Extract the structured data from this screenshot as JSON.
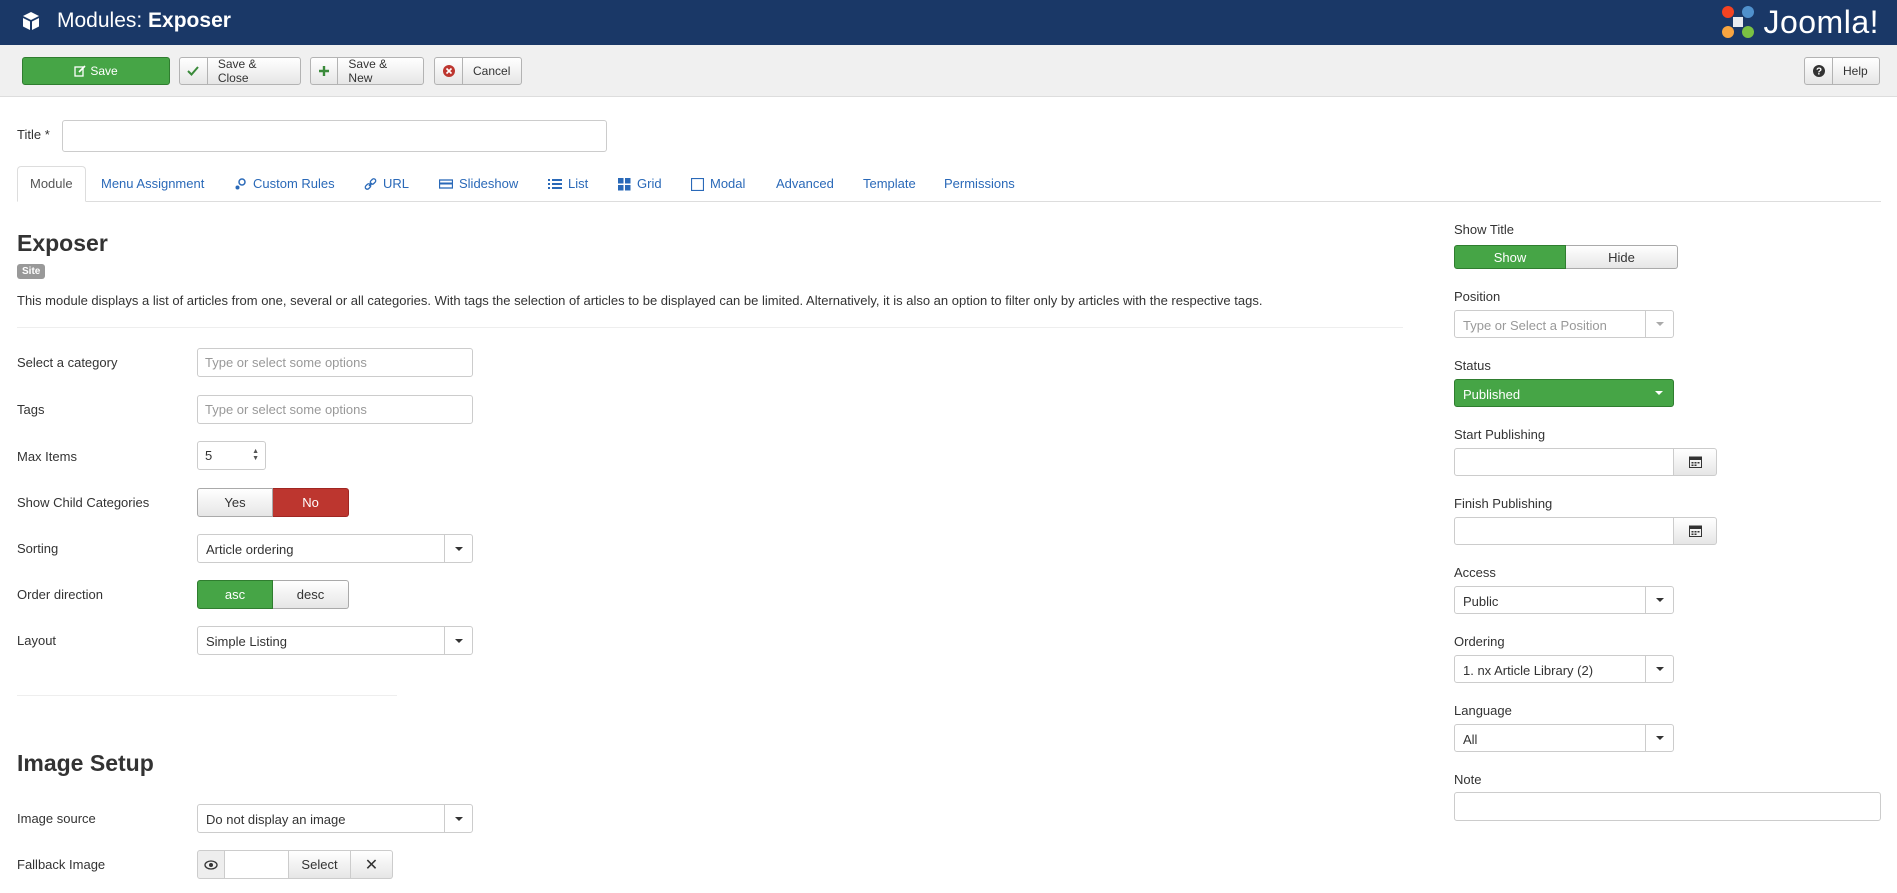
{
  "header": {
    "title_prefix": "Modules: ",
    "title_name": "Exposer",
    "brand": "Joomla!",
    "colors": {
      "bar": "#1a3867",
      "success": "#46a546",
      "danger": "#bd362f",
      "link": "#2a69b8"
    }
  },
  "toolbar": {
    "save": "Save",
    "save_close": "Save & Close",
    "save_new": "Save & New",
    "cancel": "Cancel",
    "help": "Help"
  },
  "title_field": {
    "label": "Title *",
    "value": ""
  },
  "tabs": [
    {
      "label": "Module",
      "icon": ""
    },
    {
      "label": "Menu Assignment",
      "icon": ""
    },
    {
      "label": "Custom Rules",
      "icon": "rules-icon"
    },
    {
      "label": "URL",
      "icon": "link-icon"
    },
    {
      "label": "Slideshow",
      "icon": "slideshow-icon"
    },
    {
      "label": "List",
      "icon": "list-icon"
    },
    {
      "label": "Grid",
      "icon": "grid-icon"
    },
    {
      "label": "Modal",
      "icon": "modal-icon"
    },
    {
      "label": "Advanced",
      "icon": ""
    },
    {
      "label": "Template",
      "icon": ""
    },
    {
      "label": "Permissions",
      "icon": ""
    }
  ],
  "module": {
    "name": "Exposer",
    "badge": "Site",
    "description": "This module displays a list of articles from one, several or all categories. With tags the selection of articles to be displayed can be limited. Alternatively, it is also an option to filter only by articles with the respective tags."
  },
  "fields": {
    "category": {
      "label": "Select a category",
      "placeholder": "Type or select some options"
    },
    "tags": {
      "label": "Tags",
      "placeholder": "Type or select some options"
    },
    "max_items": {
      "label": "Max Items",
      "value": "5"
    },
    "child_categories": {
      "label": "Show Child Categories",
      "yes": "Yes",
      "no": "No",
      "selected": "No"
    },
    "sorting": {
      "label": "Sorting",
      "value": "Article ordering"
    },
    "order_direction": {
      "label": "Order direction",
      "asc": "asc",
      "desc": "desc",
      "selected": "asc"
    },
    "layout": {
      "label": "Layout",
      "value": "Simple Listing"
    }
  },
  "image_setup": {
    "title": "Image Setup",
    "source": {
      "label": "Image source",
      "value": "Do not display an image"
    },
    "fallback": {
      "label": "Fallback Image",
      "select": "Select"
    }
  },
  "sidebar": {
    "show_title": {
      "label": "Show Title",
      "show": "Show",
      "hide": "Hide",
      "selected": "Show"
    },
    "position": {
      "label": "Position",
      "placeholder": "Type or Select a Position"
    },
    "status": {
      "label": "Status",
      "value": "Published"
    },
    "start_publishing": {
      "label": "Start Publishing",
      "value": ""
    },
    "finish_publishing": {
      "label": "Finish Publishing",
      "value": ""
    },
    "access": {
      "label": "Access",
      "value": "Public"
    },
    "ordering": {
      "label": "Ordering",
      "value": "1. nx Article Library (2)"
    },
    "language": {
      "label": "Language",
      "value": "All"
    },
    "note": {
      "label": "Note",
      "value": ""
    }
  }
}
